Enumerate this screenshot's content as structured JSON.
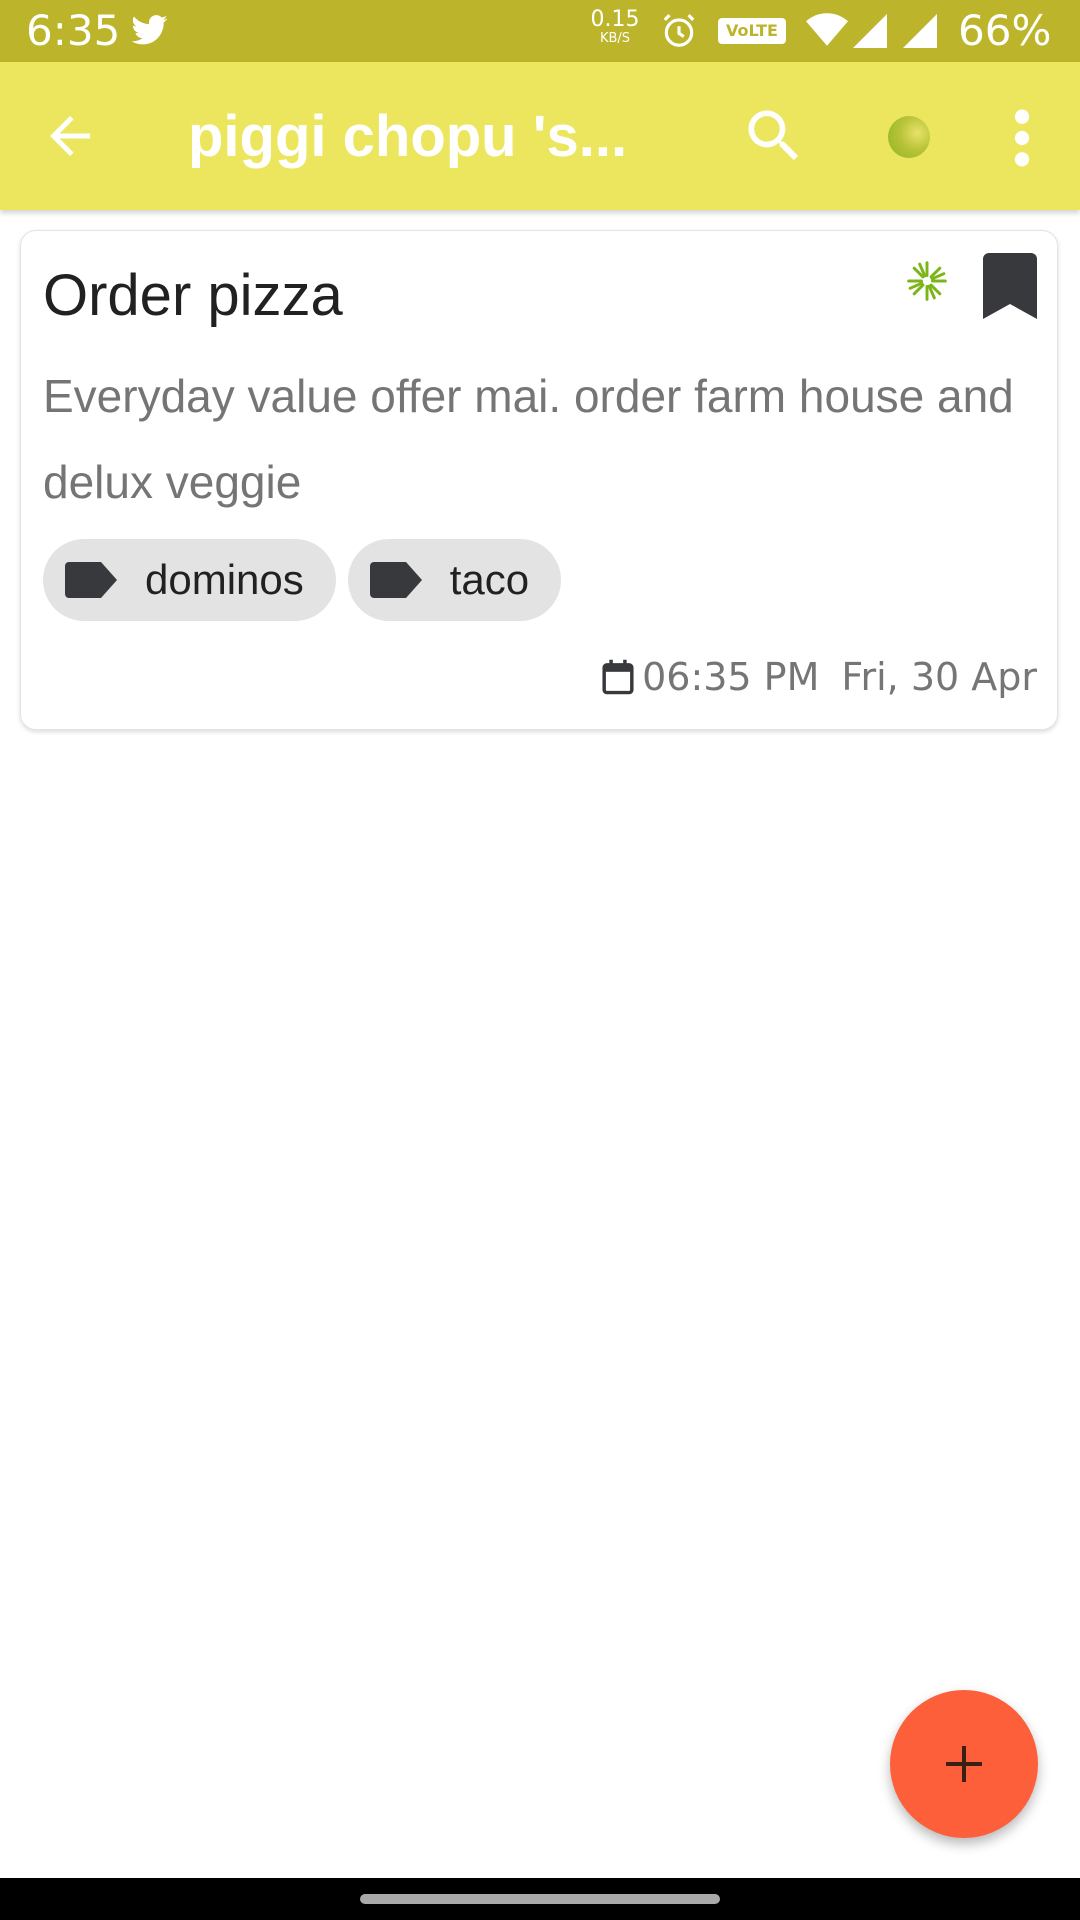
{
  "status_bar": {
    "time": "6:35",
    "net_speed": "0.15",
    "net_speed_unit": "KB/S",
    "volte": "VoLTE",
    "battery": "66%",
    "color": "#bcb52b"
  },
  "app_bar": {
    "title": "piggi chopu 's...",
    "color": "#ece65e",
    "icons": [
      "arrow-back-icon",
      "search-icon",
      "color-dot-icon",
      "more-vert-icon"
    ]
  },
  "note": {
    "title": "Order pizza",
    "body": "Everyday value offer mai. order farm house and delux veggie",
    "tags": [
      {
        "label": "dominos"
      },
      {
        "label": "taco"
      }
    ],
    "time": "06:35 PM",
    "date": "Fri, 30 Apr",
    "accent_icon": "sparkle-icon",
    "accent_color": "#7cb518",
    "pinned_icon": "bookmark-icon"
  },
  "fab": {
    "icon": "plus-icon",
    "color": "#fc5f3a"
  }
}
